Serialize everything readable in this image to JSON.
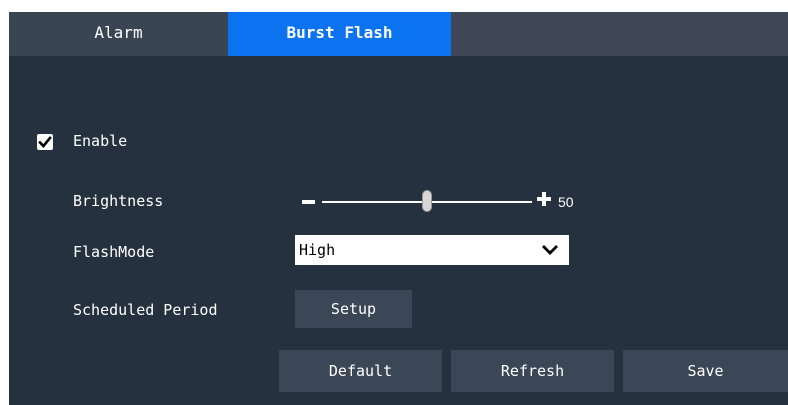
{
  "tabs": {
    "alarm": "Alarm",
    "burst_flash": "Burst Flash",
    "active": "Burst Flash"
  },
  "enable": {
    "label": "Enable",
    "checked": true
  },
  "brightness": {
    "label": "Brightness",
    "value": "50",
    "level_fraction": 0.5
  },
  "flash_mode": {
    "label": "FlashMode",
    "selected": "High"
  },
  "schedule": {
    "label": "Scheduled Period",
    "setup_label": "Setup"
  },
  "footer": {
    "default_label": "Default",
    "refresh_label": "Refresh",
    "save_label": "Save"
  },
  "colors": {
    "panel_bg": "#25313f",
    "tab_active": "#0b72f0",
    "tab_inactive": "#3a4554",
    "button_bg": "#3b4757"
  },
  "icons": {
    "checkbox": "checkmark-icon",
    "minus": "minus-icon",
    "plus": "plus-icon",
    "dropdown": "chevron-down-icon"
  }
}
